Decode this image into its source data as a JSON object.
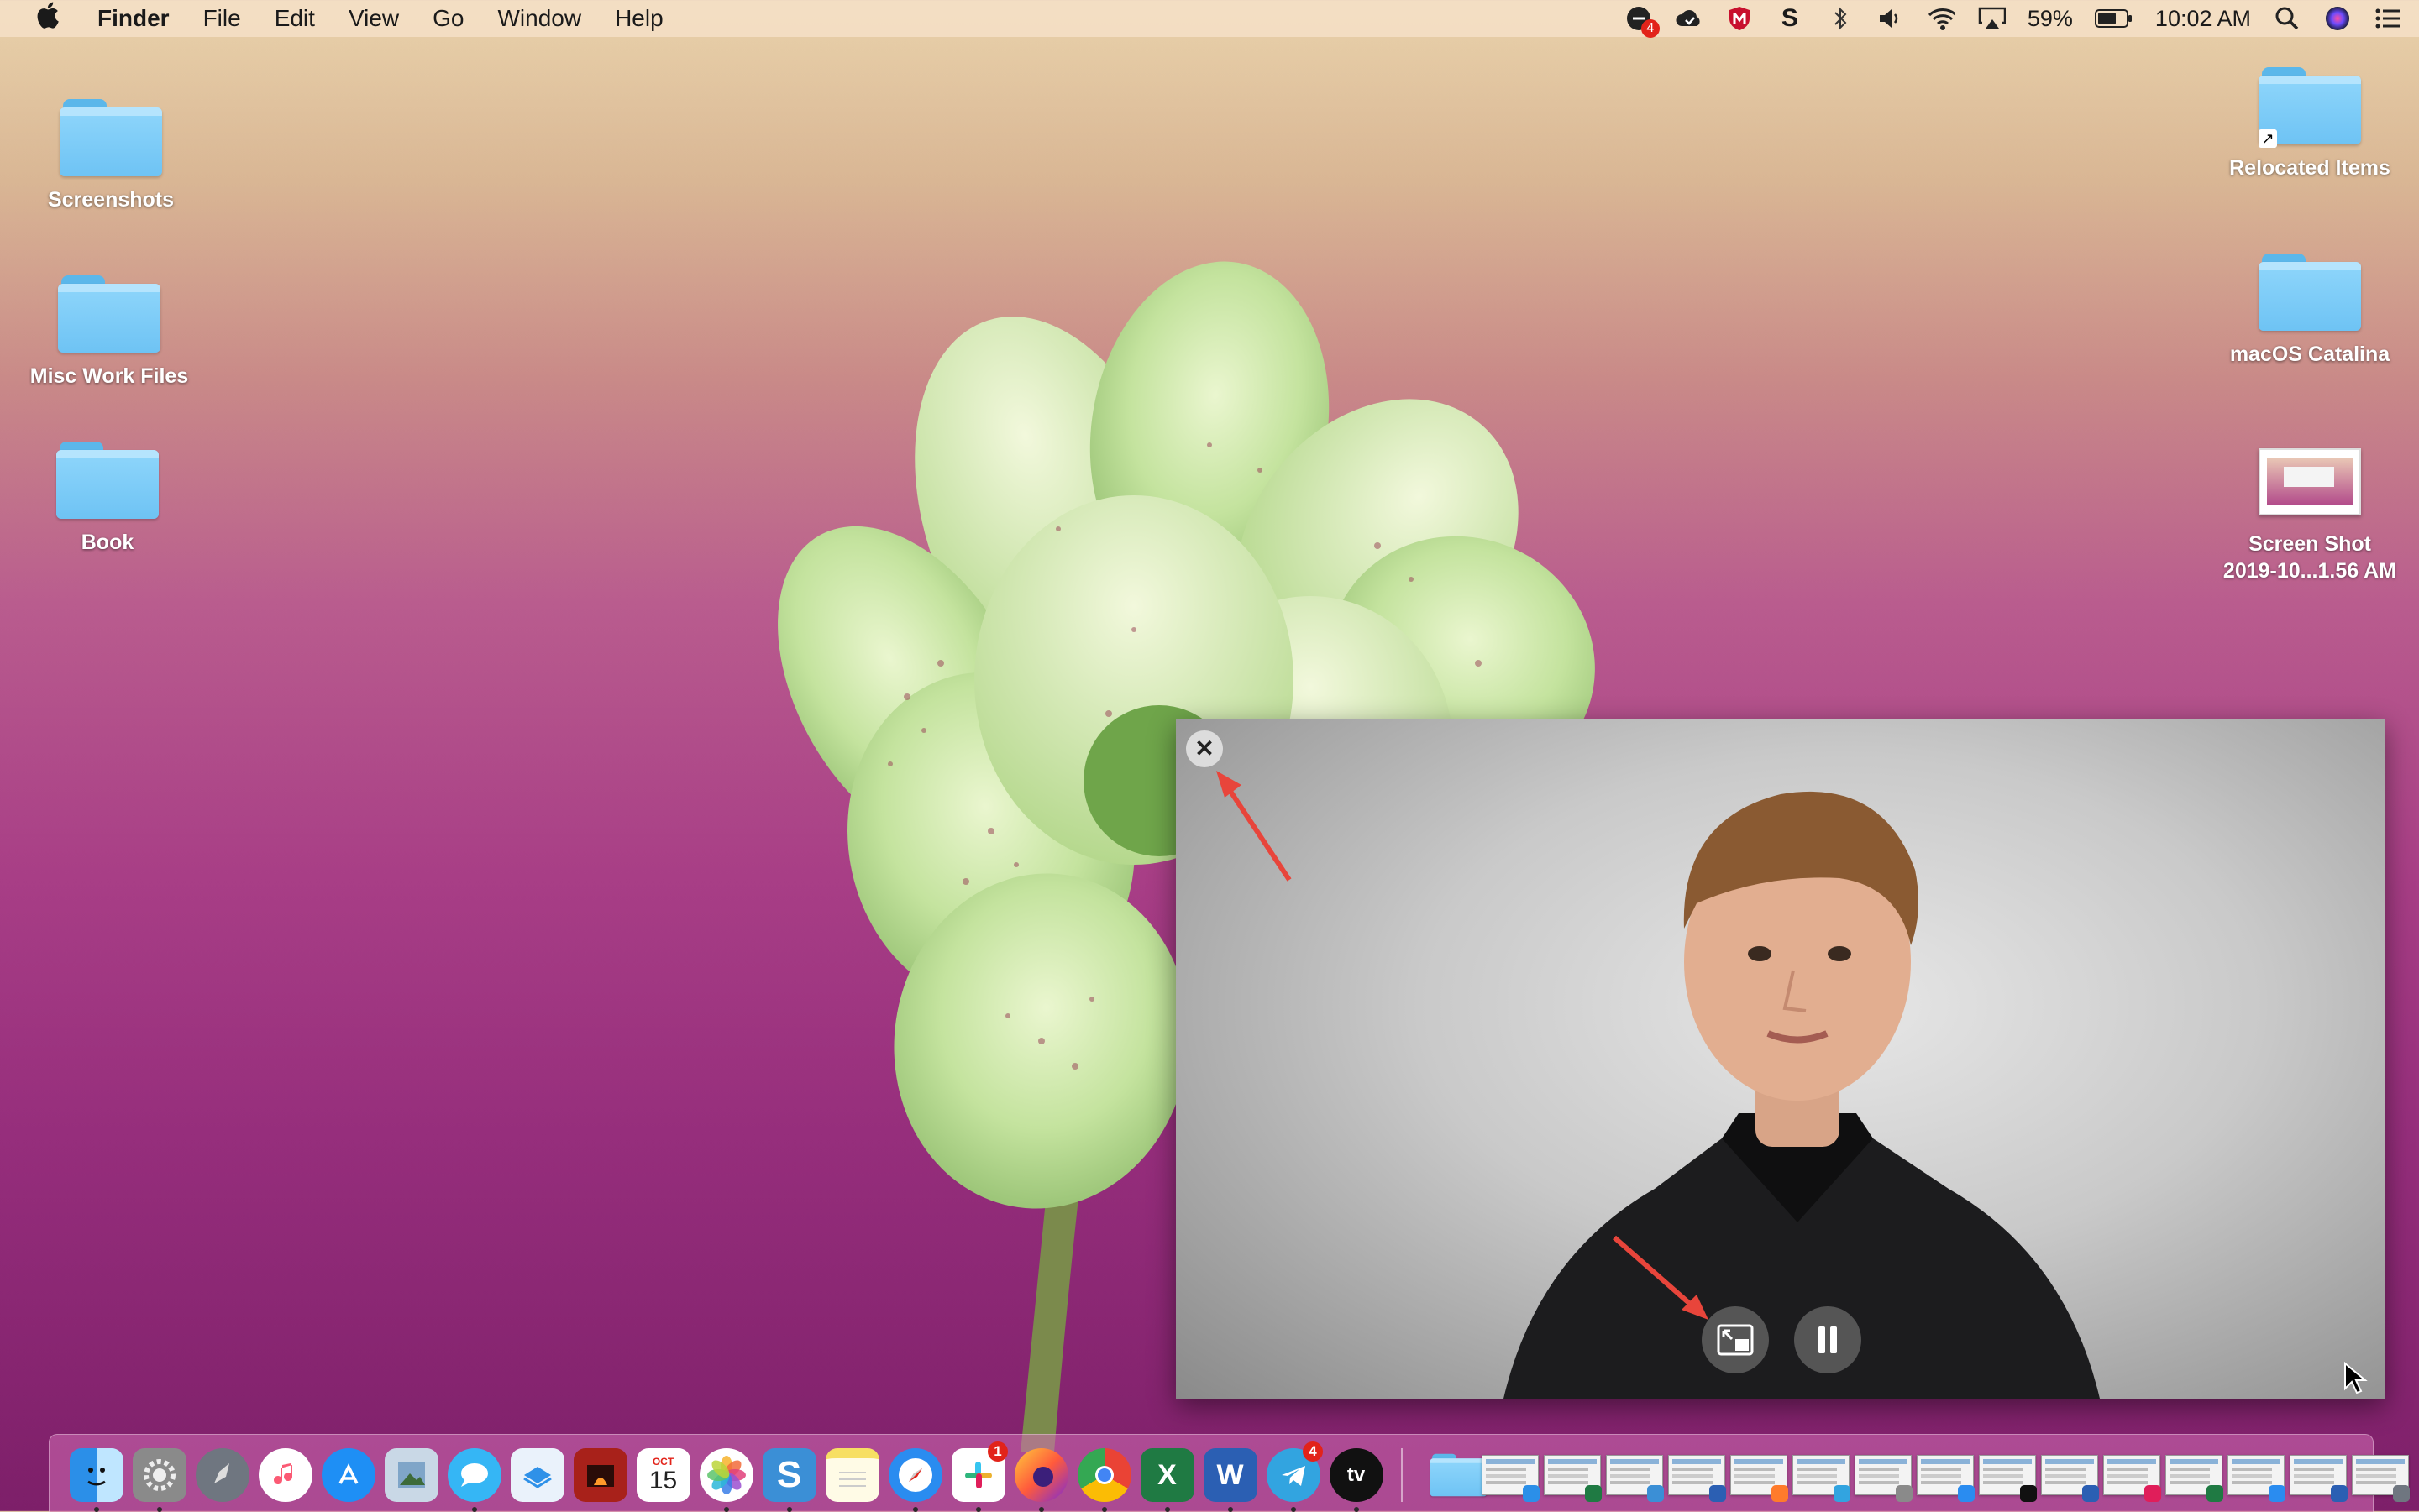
{
  "menubar": {
    "app_name": "Finder",
    "menus": [
      "File",
      "Edit",
      "View",
      "Go",
      "Window",
      "Help"
    ],
    "status": {
      "notification_badge": "4",
      "battery_percent": "59%",
      "clock": "10:02 AM"
    }
  },
  "desktop": {
    "left_icons": [
      {
        "label": "Screenshots",
        "kind": "folder"
      },
      {
        "label": "Misc Work Files",
        "kind": "folder"
      },
      {
        "label": "Book",
        "kind": "folder"
      }
    ],
    "right_icons": [
      {
        "label": "Relocated Items",
        "kind": "folder-alias"
      },
      {
        "label": "macOS Catalina",
        "kind": "folder"
      },
      {
        "label_line1": "Screen Shot",
        "label_line2": "2019-10...1.56 AM",
        "kind": "screenshot"
      }
    ]
  },
  "pip": {
    "close_label": "✕",
    "controls": [
      "restore-pip-icon",
      "pause-icon"
    ]
  },
  "dock": {
    "apps": [
      {
        "name": "Finder",
        "icon": "finder-icon",
        "color": "#3aa0f0"
      },
      {
        "name": "System Preferences",
        "icon": "gear-icon",
        "color": "#8a8a8a"
      },
      {
        "name": "Launchpad",
        "icon": "rocket-icon",
        "color": "#6f7680"
      },
      {
        "name": "Music",
        "icon": "music-icon",
        "color": "#fb5a74"
      },
      {
        "name": "App Store",
        "icon": "appstore-icon",
        "color": "#1e8ff5"
      },
      {
        "name": "Preview",
        "icon": "preview-icon",
        "color": "#7fa5c8"
      },
      {
        "name": "Messages",
        "icon": "messages-icon",
        "color": "#35b6f5"
      },
      {
        "name": "Pages",
        "icon": "pages-icon",
        "color": "#2f91e8"
      },
      {
        "name": "Photo Booth",
        "icon": "photobooth-icon",
        "color": "#a8211a"
      },
      {
        "name": "Calendar",
        "icon": "calendar-icon",
        "color": "#ffffff",
        "month": "OCT",
        "day": "15"
      },
      {
        "name": "Photos",
        "icon": "photos-icon",
        "color": "#ffffff"
      },
      {
        "name": "Scrivener",
        "icon": "s-icon",
        "color": "#3b8fd6"
      },
      {
        "name": "Notes",
        "icon": "notes-icon",
        "color": "#f7df63"
      },
      {
        "name": "Safari",
        "icon": "safari-icon",
        "color": "#2a8cf0"
      },
      {
        "name": "Slack",
        "icon": "slack-icon",
        "color": "#ffffff",
        "badge": "1"
      },
      {
        "name": "Firefox",
        "icon": "firefox-icon",
        "color": "#ff7b2b"
      },
      {
        "name": "Chrome",
        "icon": "chrome-icon",
        "color": "#ffffff"
      },
      {
        "name": "Excel",
        "icon": "excel-icon",
        "color": "#1f7a43",
        "letter": "X"
      },
      {
        "name": "Word",
        "icon": "word-icon",
        "color": "#2b5fb3",
        "letter": "W"
      },
      {
        "name": "Telegram",
        "icon": "telegram-icon",
        "color": "#32a4e0",
        "badge": "4"
      },
      {
        "name": "TV",
        "icon": "appletv-icon",
        "color": "#111111",
        "letter": "tv"
      }
    ],
    "minimized_count": 15
  }
}
